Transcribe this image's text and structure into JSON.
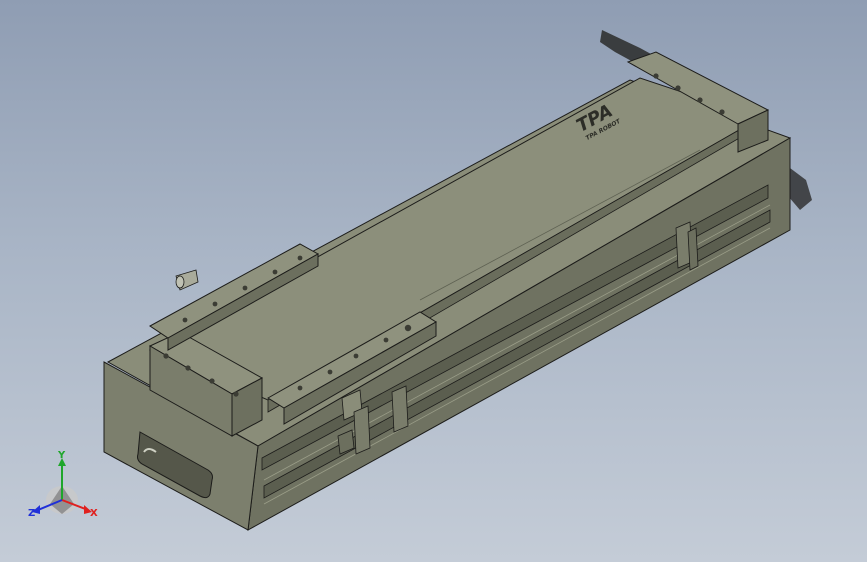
{
  "logo": {
    "brand": "TPA",
    "tagline": "TPA ROBOT"
  },
  "triad": {
    "x_label": "X",
    "y_label": "Y",
    "z_label": "Z",
    "x_color": "#e0201e",
    "y_color": "#1fa62b",
    "z_color": "#2030d8"
  },
  "colors": {
    "background_top": "#8f9db3",
    "background_bottom": "#c4ccd7",
    "body_top": "#878b78",
    "body_side": "#6d705f",
    "body_end": "#7b7e6c",
    "edge": "#1c1c1a"
  }
}
